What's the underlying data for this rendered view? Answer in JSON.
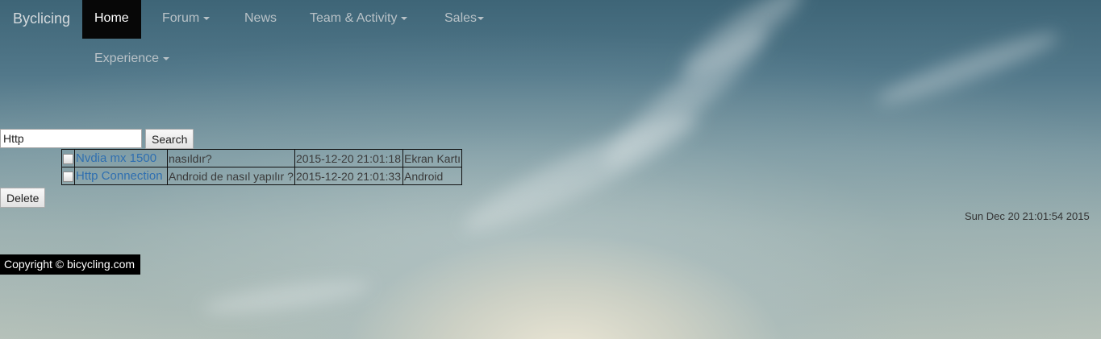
{
  "nav": {
    "brand": "Byclicing",
    "items": [
      {
        "label": "Home",
        "active": true,
        "dropdown": false
      },
      {
        "label": "Forum",
        "dropdown": true
      },
      {
        "label": "News",
        "dropdown": false
      },
      {
        "label": "Team & Activity",
        "dropdown": true
      },
      {
        "label": "Sales",
        "dropdown": true
      },
      {
        "label": "Experience",
        "dropdown": true
      }
    ]
  },
  "search": {
    "value": "Http",
    "button_label": "Search"
  },
  "posts": {
    "rows": [
      {
        "title": "Nvdia mx 1500",
        "description": "nasıldır?",
        "date": "2015-12-20 21:01:18",
        "category": "Ekran Kartı"
      },
      {
        "title": "Http Connection",
        "description": "Android de nasıl yapılır ?",
        "date": "2015-12-20 21:01:33",
        "category": "Android"
      }
    ],
    "delete_label": "Delete"
  },
  "clock": "Sun Dec 20 21:01:54 2015",
  "footer": {
    "copyright": "Copyright © bicycling.com"
  },
  "colors": {
    "navbar_active_bg": "#070707",
    "link": "#2f6fb0",
    "footer_bg": "#000000"
  }
}
